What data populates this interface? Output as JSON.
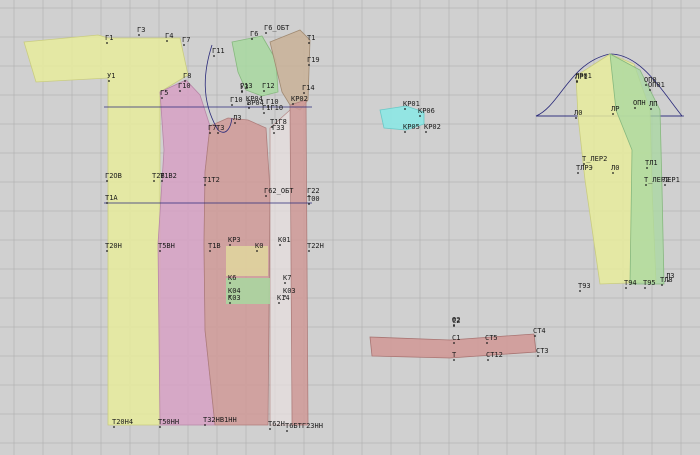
{
  "palette": {
    "background": "#d0d0d0",
    "grid": "#b4b4b4",
    "yellow": "#e8ec9c",
    "pink": "#d7a1c4",
    "red": "#d09a98",
    "green": "#a8d8a0",
    "brown": "#c9b39a",
    "cyan": "#8fe6e4",
    "navy": "#2a2a7a"
  },
  "pieces": {
    "back_shelf": {
      "name": "back-shelf-piece",
      "color_key": "yellow"
    },
    "side_panel": {
      "name": "side-panel-piece",
      "color_key": "pink"
    },
    "front_panel": {
      "name": "front-panel-piece",
      "color_key": "red"
    },
    "shoulder_yoke": {
      "name": "shoulder-yoke-piece",
      "color_key": "green"
    },
    "front_strip": {
      "name": "front-strip-piece",
      "color_key": "brown"
    },
    "pocket_flap": {
      "name": "pocket-flap-piece",
      "color_key": "cyan"
    },
    "collar": {
      "name": "collar-piece",
      "color_key": "red"
    },
    "sleeve_back": {
      "name": "sleeve-back-piece",
      "color_key": "yellow"
    },
    "sleeve_front": {
      "name": "sleeve-front-piece",
      "color_key": "green"
    }
  },
  "labels": [
    "Г3",
    "Г4",
    "Г7",
    "Г1",
    "Г6_ОБТ",
    "Г6",
    "Т1",
    "Г11",
    "Г19",
    "У1",
    "Г8",
    "Г5",
    "Г10",
    "Г13",
    "Г12",
    "У3",
    "Г10",
    "Л3",
    "Г10",
    "Г1Г10",
    "КР04",
    "ВР04",
    "КР02",
    "Г14",
    "Г7",
    "Т1Г8",
    "Г33",
    "Т3",
    "Г2ОВ",
    "Т2В",
    "Т1В2",
    "Т1Т2",
    "Г62_ОБТ",
    "Г22",
    "Т1А",
    "Т00",
    "Т20Н",
    "Т5ВН",
    "Т1В",
    "КР3",
    "К01",
    "К0",
    "Т22Н",
    "К6",
    "К7",
    "К04",
    "К03",
    "К14",
    "К03",
    "Т20Н4",
    "Т50НН",
    "Т32НВ1НН",
    "Т62Н",
    "Т6БТГ2ЗНН",
    "КР01",
    "КР06",
    "КР05",
    "КР02",
    "Ф2",
    "ЛР01",
    "ЛР1",
    "ОП0",
    "ОП01",
    "Л0",
    "ЛР",
    "ОПН",
    "ЛП",
    "Т_ЛЕР2",
    "ТЛРЭ",
    "Л0",
    "Т_ЛЕР2",
    "ЛЕР1",
    "ТЛ1",
    "Т93",
    "Т94",
    "Т95",
    "ТЛ8",
    "ЛЗ",
    "СТ4",
    "С2",
    "С1",
    "СТ5",
    "СТ3",
    "Т",
    "СТ12"
  ]
}
